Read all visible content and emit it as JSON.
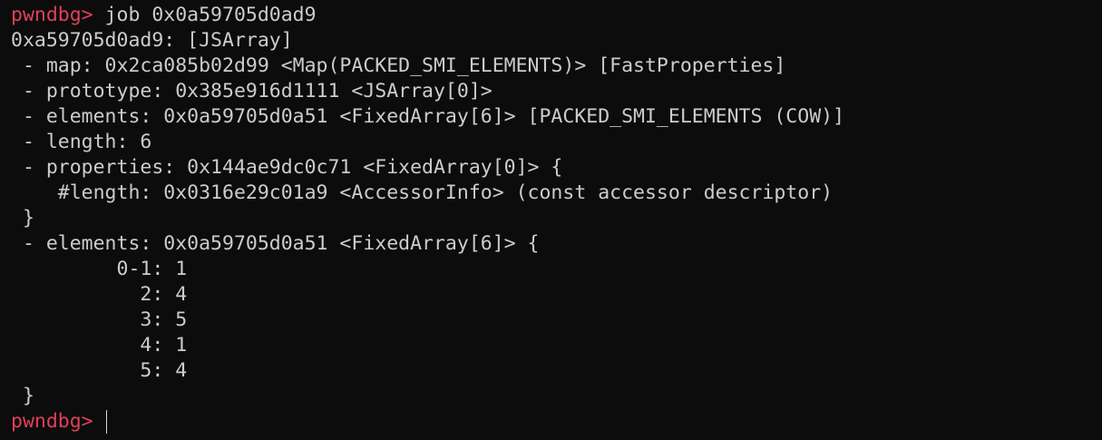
{
  "terminal": {
    "prompt": "pwndbg> ",
    "command": "job 0x0a59705d0ad9",
    "output": [
      "0xa59705d0ad9: [JSArray]",
      " - map: 0x2ca085b02d99 <Map(PACKED_SMI_ELEMENTS)> [FastProperties]",
      " - prototype: 0x385e916d1111 <JSArray[0]>",
      " - elements: 0x0a59705d0a51 <FixedArray[6]> [PACKED_SMI_ELEMENTS (COW)]",
      " - length: 6",
      " - properties: 0x144ae9dc0c71 <FixedArray[0]> {",
      "    #length: 0x0316e29c01a9 <AccessorInfo> (const accessor descriptor)",
      " }",
      " - elements: 0x0a59705d0a51 <FixedArray[6]> {",
      "         0-1: 1",
      "           2: 4",
      "           3: 5",
      "           4: 1",
      "           5: 4",
      " }"
    ],
    "current_input": "",
    "colors": {
      "background": "#0c0c0c",
      "text": "#cccccc",
      "prompt": "#e0405a",
      "cursor": "#d8d8d8"
    }
  }
}
